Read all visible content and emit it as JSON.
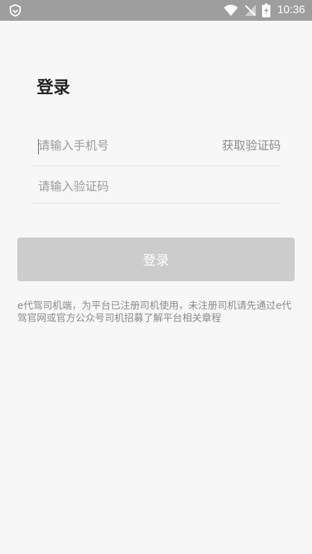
{
  "status_bar": {
    "time": "10:36",
    "icons": [
      "shield-icon",
      "wifi-icon",
      "signal-off-icon",
      "battery-charging-icon"
    ]
  },
  "login": {
    "title": "登录",
    "phone_placeholder": "请输入手机号",
    "get_code_label": "获取验证码",
    "code_placeholder": "请输入验证码",
    "submit_label": "登录"
  },
  "notice": "e代驾司机端，为平台已注册司机使用，未注册司机请先通过e代驾官网或官方公众号司机招募了解平台相关章程",
  "colors": {
    "status_bar": "#9e9e9e",
    "background": "#f7f7f7",
    "button_disabled": "#cccccc",
    "placeholder": "#9b9b9b",
    "link_text": "#8c8c8c"
  }
}
